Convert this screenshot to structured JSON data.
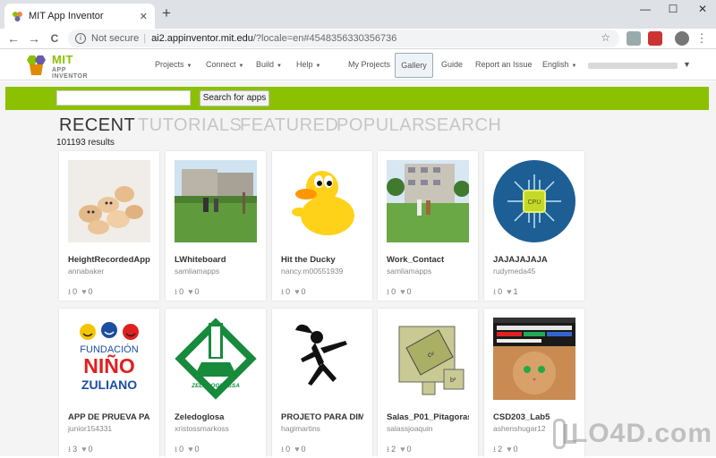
{
  "browser": {
    "tab_title": "MIT App Inventor",
    "tab_close": "✕",
    "new_tab": "+",
    "win_minimize": "—",
    "win_maximize": "☐",
    "win_close": "✕",
    "back": "←",
    "forward": "→",
    "reload": "C",
    "not_secure": "Not secure",
    "separator": "|",
    "url_domain": "ai2.appinventor.mit.edu",
    "url_path": "/?locale=en#4548356330356736",
    "star": "☆",
    "menu_dots": "⋮"
  },
  "app": {
    "logo_mit": "MIT",
    "logo_sub": "APP INVENTOR",
    "menu_caret": "▼",
    "menus": [
      "Projects",
      "Connect",
      "Build",
      "Help"
    ],
    "links": {
      "my_projects": "My Projects",
      "gallery": "Gallery",
      "guide": "Guide",
      "report": "Report an Issue",
      "language": "English"
    }
  },
  "gallery": {
    "search_placeholder": "",
    "search_button": "Search for apps",
    "categories": [
      "RECENT",
      "TUTORIALS",
      "FEATURED",
      "POPULAR",
      "SEARCH"
    ],
    "active_category": "RECENT",
    "results": "101193 results",
    "apps": [
      {
        "name": "HeightRecordedApp",
        "author": "annabaker",
        "downloads": "0",
        "likes": "0"
      },
      {
        "name": "LWhiteboard",
        "author": "samliamapps",
        "downloads": "0",
        "likes": "0"
      },
      {
        "name": "Hit the Ducky",
        "author": "nancy.m00551939",
        "downloads": "0",
        "likes": "0"
      },
      {
        "name": "Work_Contact",
        "author": "samliamapps",
        "downloads": "0",
        "likes": "0"
      },
      {
        "name": "JAJAJAJAJA",
        "author": "rudymeda45",
        "downloads": "0",
        "likes": "1"
      },
      {
        "name": "APP DE PRUEVA PARA",
        "author": "junior154331",
        "downloads": "3",
        "likes": "0"
      },
      {
        "name": "Zeledoglosa",
        "author": "xristossmarkoss",
        "downloads": "0",
        "likes": "0"
      },
      {
        "name": "PROJETO PARA DIMI",
        "author": "hagimartins",
        "downloads": "0",
        "likes": "0"
      },
      {
        "name": "Salas_P01_Pitagoras",
        "author": "salassjoaquin",
        "downloads": "2",
        "likes": "0"
      },
      {
        "name": "CSD203_Lab5",
        "author": "ashenshugar12",
        "downloads": "2",
        "likes": "0"
      }
    ],
    "image_text": {
      "fundacion_1": "FUNDACIÓN",
      "fundacion_2": "NIÑO",
      "fundacion_3": "ZULIANO",
      "zeledo": "ZELEDOGLOSSA",
      "cpu": "CPU",
      "c2": "c²",
      "b2": "b²"
    }
  },
  "watermark": "LO4D.com",
  "colors": {
    "accent_green": "#8cc101",
    "background": "#f4f4f4"
  }
}
